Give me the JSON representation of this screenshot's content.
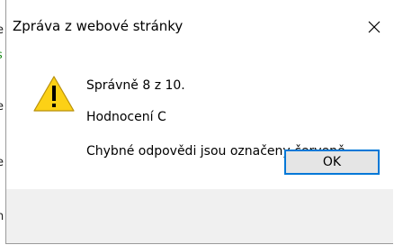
{
  "background_page": {
    "fragments": [
      "e",
      "s",
      "e",
      "e",
      "n"
    ]
  },
  "dialog": {
    "title": "Zpráva z webové stránky",
    "close_icon": "close-icon",
    "icon": "warning-icon",
    "lines": [
      "Správně 8 z 10.",
      "Hodnocení C",
      "Chybné odpovědi jsou označeny červeně."
    ],
    "ok_label": "OK"
  },
  "colors": {
    "warning_fill": "#fcd116",
    "button_border": "#0078d7",
    "button_area": "#f0f0f0"
  }
}
